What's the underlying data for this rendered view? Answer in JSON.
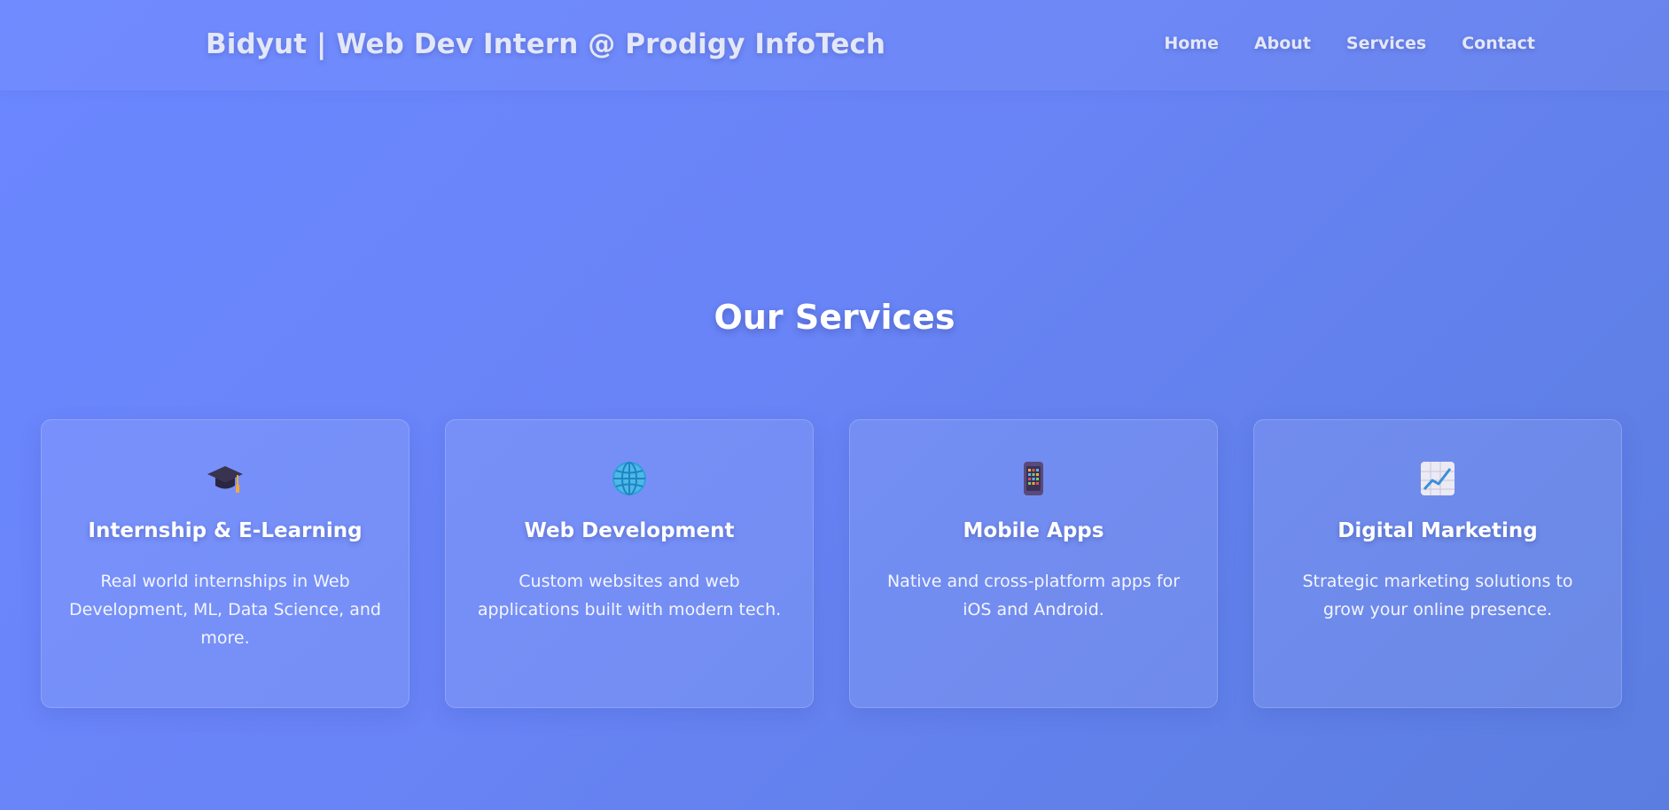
{
  "header": {
    "brand": "Bidyut | Web Dev Intern @ Prodigy InfoTech",
    "nav": [
      {
        "label": "Home"
      },
      {
        "label": "About"
      },
      {
        "label": "Services"
      },
      {
        "label": "Contact"
      }
    ]
  },
  "services": {
    "title": "Our Services",
    "cards": [
      {
        "icon": "graduation-cap-icon",
        "title": "Internship & E-Learning",
        "description": "Real world internships in Web Development, ML, Data Science, and more."
      },
      {
        "icon": "globe-icon",
        "title": "Web Development",
        "description": "Custom websites and web applications built with modern tech."
      },
      {
        "icon": "mobile-phone-icon",
        "title": "Mobile Apps",
        "description": "Native and cross-platform apps for iOS and Android."
      },
      {
        "icon": "chart-increasing-icon",
        "title": "Digital Marketing",
        "description": "Strategic marketing solutions to grow your online presence."
      }
    ]
  },
  "colors": {
    "background_start": "#6b87ff",
    "background_end": "#5b7de0",
    "text": "#ffffff",
    "nav_text": "#e3e7f7"
  }
}
